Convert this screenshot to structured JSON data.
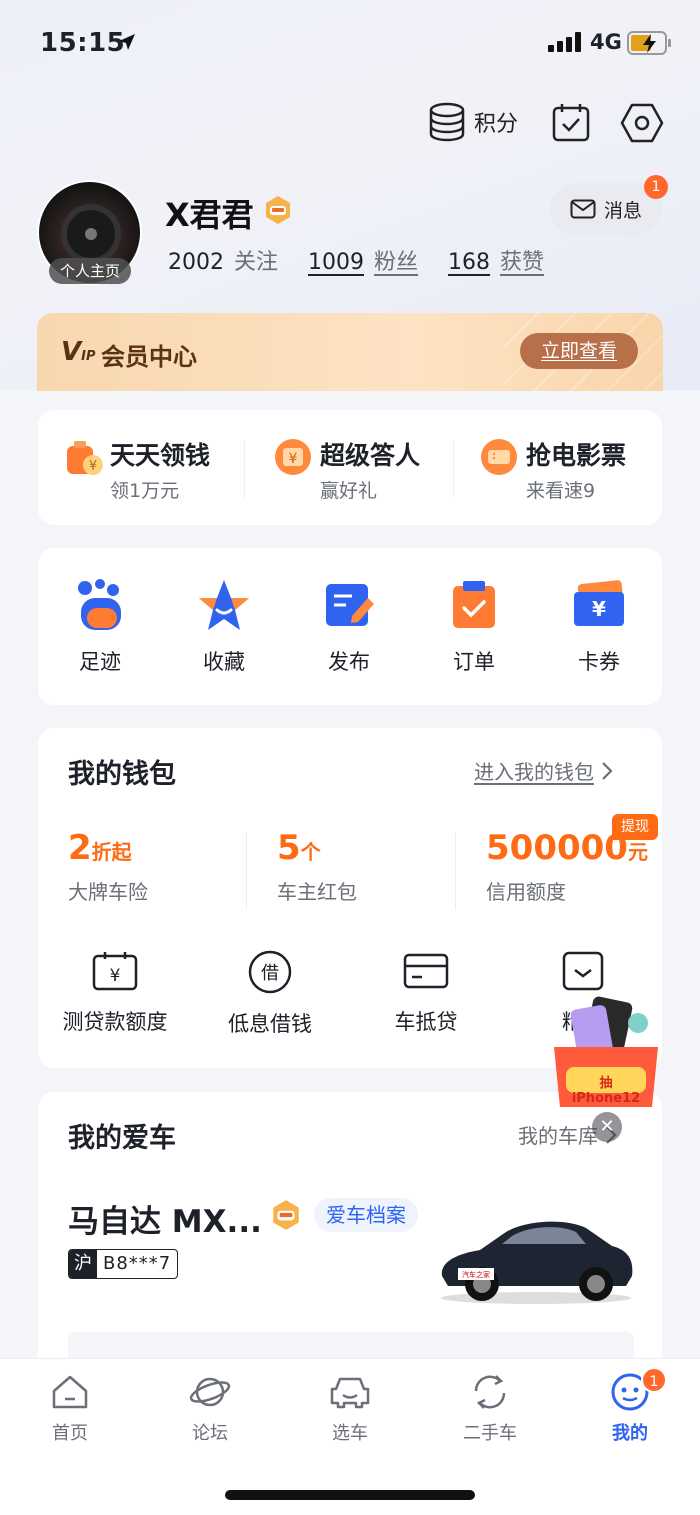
{
  "status": {
    "time": "15:15",
    "network": "4G"
  },
  "toolbar": {
    "points_label": "积分"
  },
  "user": {
    "name": "X君君",
    "avatar_tag": "个人主页",
    "following": "2002",
    "following_label": "关注",
    "fans": "1009",
    "fans_label": "粉丝",
    "likes": "168",
    "likes_label": "获赞"
  },
  "message": {
    "label": "消息",
    "badge": "1"
  },
  "vip": {
    "logo": "V",
    "logo_sub": "IP",
    "title": "会员中心",
    "button": "立即查看"
  },
  "promos": [
    {
      "title": "天天领钱",
      "sub": "领1万元"
    },
    {
      "title": "超级答人",
      "sub": "赢好礼"
    },
    {
      "title": "抢电影票",
      "sub": "来看速9"
    }
  ],
  "quick": [
    {
      "label": "足迹"
    },
    {
      "label": "收藏"
    },
    {
      "label": "发布"
    },
    {
      "label": "订单"
    },
    {
      "label": "卡券"
    }
  ],
  "wallet": {
    "title": "我的钱包",
    "link": "进入我的钱包",
    "stats": [
      {
        "big": "2",
        "unit": "折起",
        "desc": "大牌车险"
      },
      {
        "big": "5",
        "unit": "个",
        "desc": "车主红包"
      },
      {
        "big": "500000",
        "unit": "元",
        "desc": "信用额度"
      }
    ],
    "badge": "提现",
    "tools": [
      {
        "label": "测贷款额度"
      },
      {
        "label": "低息借钱"
      },
      {
        "label": "车抵贷"
      },
      {
        "label": "精选"
      }
    ]
  },
  "car": {
    "title": "我的爱车",
    "link": "我的车库",
    "name": "马自达 MX...",
    "archive": "爱车档案",
    "plate_prov": "沪",
    "plate_num": "B8***7",
    "image_text": "汽车之家"
  },
  "float_ad": {
    "label": "抽iPhone12"
  },
  "tabs": [
    {
      "label": "首页"
    },
    {
      "label": "论坛"
    },
    {
      "label": "选车"
    },
    {
      "label": "二手车"
    },
    {
      "label": "我的"
    }
  ],
  "tab_badge": "1",
  "colors": {
    "accent": "#2f63f0",
    "orange": "#ff6a14",
    "badge": "#ff6a2c"
  }
}
